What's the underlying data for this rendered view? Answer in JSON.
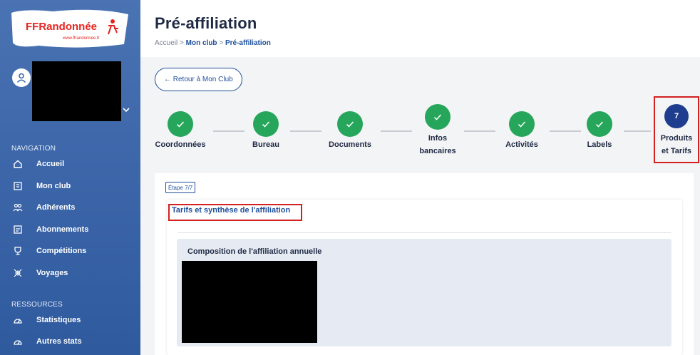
{
  "brand": {
    "logo_text": "FFRandonnée",
    "logo_url_text": "www.ffrandonnee.fr",
    "logo_color": "#e52420"
  },
  "sidebar": {
    "navigation_label": "NAVIGATION",
    "nav_items": [
      {
        "label": "Accueil",
        "icon": "home-icon"
      },
      {
        "label": "Mon club",
        "icon": "building-icon"
      },
      {
        "label": "Adhérents",
        "icon": "users-icon"
      },
      {
        "label": "Abonnements",
        "icon": "card-icon"
      },
      {
        "label": "Compétitions",
        "icon": "trophy-icon"
      },
      {
        "label": "Voyages",
        "icon": "travel-icon"
      }
    ],
    "ressources_label": "RESSOURCES",
    "ressource_items": [
      {
        "label": "Statistiques",
        "icon": "gauge-icon"
      },
      {
        "label": "Autres stats",
        "icon": "gauge-icon"
      }
    ]
  },
  "header": {
    "title": "Pré-affiliation",
    "breadcrumb": {
      "home": "Accueil",
      "sep": ">",
      "club": "Mon club",
      "current": "Pré-affiliation"
    }
  },
  "back_button": "← Retour à Mon Club",
  "stepper": {
    "steps": [
      {
        "label": "Coordonnées",
        "status": "done"
      },
      {
        "label": "Bureau",
        "status": "done"
      },
      {
        "label": "Documents",
        "status": "done"
      },
      {
        "label_line1": "Infos",
        "label_line2": "bancaires",
        "status": "done"
      },
      {
        "label": "Activités",
        "status": "done"
      },
      {
        "label": "Labels",
        "status": "done"
      },
      {
        "number": "7",
        "label_line1": "Produits",
        "label_line2": "et Tarifs",
        "status": "active"
      }
    ],
    "done_color": "#26a65b",
    "active_color": "#1e3d8f"
  },
  "content": {
    "step_badge": "Étape 7/7",
    "section_title": "Tarifs et synthèse de l'affiliation",
    "composition_title": "Composition de l'affiliation annuelle"
  },
  "colors": {
    "highlight": "#d42020",
    "link": "#1f4f9a",
    "sidebar": "#3e68aa"
  }
}
